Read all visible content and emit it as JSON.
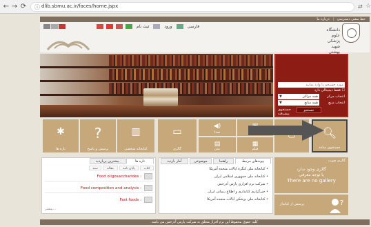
{
  "browser": {
    "url": "dlib.sbmu.ac.ir/faces/home.jspx",
    "back_icon": "arrow-left",
    "forward_icon": "arrow-right",
    "reload_icon": "reload"
  },
  "topbar": {
    "items": [
      "خط مشی دسترسی",
      "درباره ما"
    ]
  },
  "toolbar": {
    "register": "ثبت نام",
    "login": "ورود",
    "language": "فارسی"
  },
  "logo": {
    "text": "دانشگاه علوم پزشکی شهید بهشتی"
  },
  "search": {
    "input_placeholder": "مورد جستجو را وارد نمایید",
    "digital_checkbox": "فقط دیجیتالی دارد",
    "center_label": "انتخاب مرکز",
    "center_value": "همه مراکز",
    "source_label": "انتخاب منبع",
    "source_value": "همه منابع",
    "advanced_link": "جستجوی پیشرفته",
    "search_button": "جستجو"
  },
  "tiles": [
    {
      "label": "تازه ها",
      "icon": "star-doc-icon"
    },
    {
      "label": "پرسش و پاسخ",
      "icon": "question-icon"
    },
    {
      "label": "کتابخانه شخصی",
      "icon": "books-icon"
    },
    {
      "label": "گالری",
      "icon": "monitor-icon"
    },
    {
      "label": "صدا",
      "icon": "speaker-icon"
    },
    {
      "label": "متن",
      "icon": "text-icon"
    },
    {
      "label": "فیلم",
      "icon": "film-icon"
    },
    {
      "label": "تصاویر",
      "icon": "image-icon"
    },
    {
      "label": "جستجوی ساده",
      "icon": "magnifier-icon"
    }
  ],
  "left_panel": {
    "tabs": [
      "تازه ها",
      "بیشترین پربازدید"
    ],
    "subtabs": [
      "کتاب",
      "پایان نامه",
      "مقاله",
      "سند"
    ],
    "rows": [
      "Food oligosaccharides :",
      "Food composition and analysis :",
      "Fast foods :"
    ],
    "more": "بیشتر..."
  },
  "right_panel": {
    "tabs": [
      "پیوندهای مرتبط",
      "راهنما",
      "موضوعی",
      "آمار بازدید"
    ],
    "links": [
      "کتابخانه ملی کنگره ایالات متحده آمریکا",
      "کتابخانه ملی جمهوری اسلامی ایران",
      "شرکت نرم افزاری پارس آذرخش",
      "خبرگزاری کتابداری و اطلاع رسانی ایران",
      "کتابخانه ملی پزشکی ایالات متحده آمریکا"
    ]
  },
  "gallery": {
    "title": "گالری صوت",
    "msg_fa": "گالری وجود ندارد",
    "msg_fa2": "یا توجه معرفی",
    "msg_en": "There are no gallery"
  },
  "ask": {
    "label": "پرسش از کتابدار"
  },
  "footer": {
    "text": "کلیه حقوق محفوظ این نرم افزار متعلق به شرکت پارس آذرخش می باشد"
  }
}
